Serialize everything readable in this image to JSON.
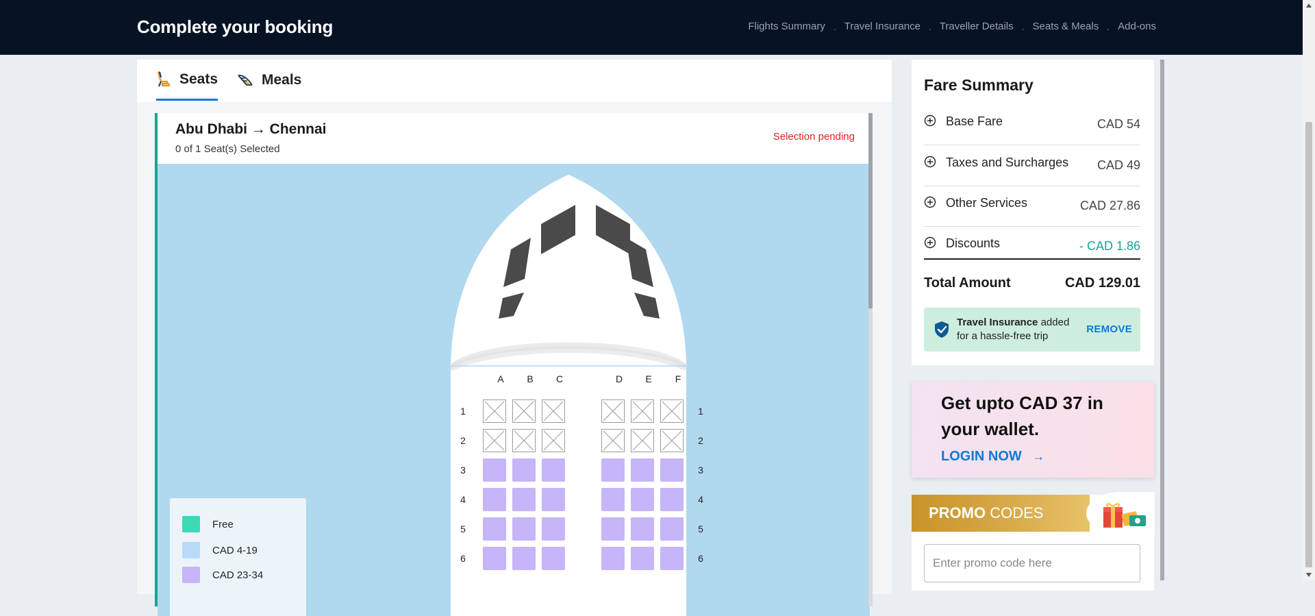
{
  "header": {
    "title": "Complete your booking",
    "steps": [
      "Flights Summary",
      "Travel Insurance",
      "Traveller Details",
      "Seats & Meals",
      "Add-ons"
    ],
    "separator": "."
  },
  "tabs": [
    {
      "label": "Seats",
      "icon": "seat-icon",
      "active": true
    },
    {
      "label": "Meals",
      "icon": "meal-icon",
      "active": false
    }
  ],
  "segment": {
    "route": "Abu Dhabi → Chennai",
    "selected_text": "0 of 1 Seat(s) Selected",
    "status": "Selection pending",
    "status_color": "#e0201e"
  },
  "seat_map": {
    "columns_left": [
      "A",
      "B",
      "C"
    ],
    "columns_right": [
      "D",
      "E",
      "F"
    ],
    "rows": [
      {
        "num": "1",
        "state": "unavailable"
      },
      {
        "num": "2",
        "state": "unavailable"
      },
      {
        "num": "3",
        "state": "paid"
      },
      {
        "num": "4",
        "state": "paid"
      },
      {
        "num": "5",
        "state": "paid"
      },
      {
        "num": "6",
        "state": "paid"
      }
    ],
    "colors": {
      "paid": "#c6b5f8",
      "background": "#b0d8ef"
    }
  },
  "legend": [
    {
      "label": "Free",
      "color": "#3fd8b5"
    },
    {
      "label": "CAD 4-19",
      "color": "#b8dbfa"
    },
    {
      "label": "CAD 23-34",
      "color": "#c6b5f8"
    }
  ],
  "fare_summary": {
    "title": "Fare Summary",
    "rows": [
      {
        "label": "Base Fare",
        "value": "CAD 54"
      },
      {
        "label": "Taxes and Surcharges",
        "value": "CAD 49"
      },
      {
        "label": "Other Services",
        "value": "CAD 27.86"
      },
      {
        "label": "Discounts",
        "value": "- CAD 1.86"
      }
    ],
    "total_label": "Total Amount",
    "total_value": "CAD 129.01",
    "insurance": {
      "bold": "Travel Insurance",
      "text": " added for a hassle-free trip",
      "action": "REMOVE"
    }
  },
  "wallet": {
    "message": "Get upto CAD 37 in your wallet.",
    "action": "LOGIN NOW",
    "arrow": "→"
  },
  "promo": {
    "title_bold": "PROMO",
    "title_light": " CODES",
    "placeholder": "Enter promo code here"
  }
}
